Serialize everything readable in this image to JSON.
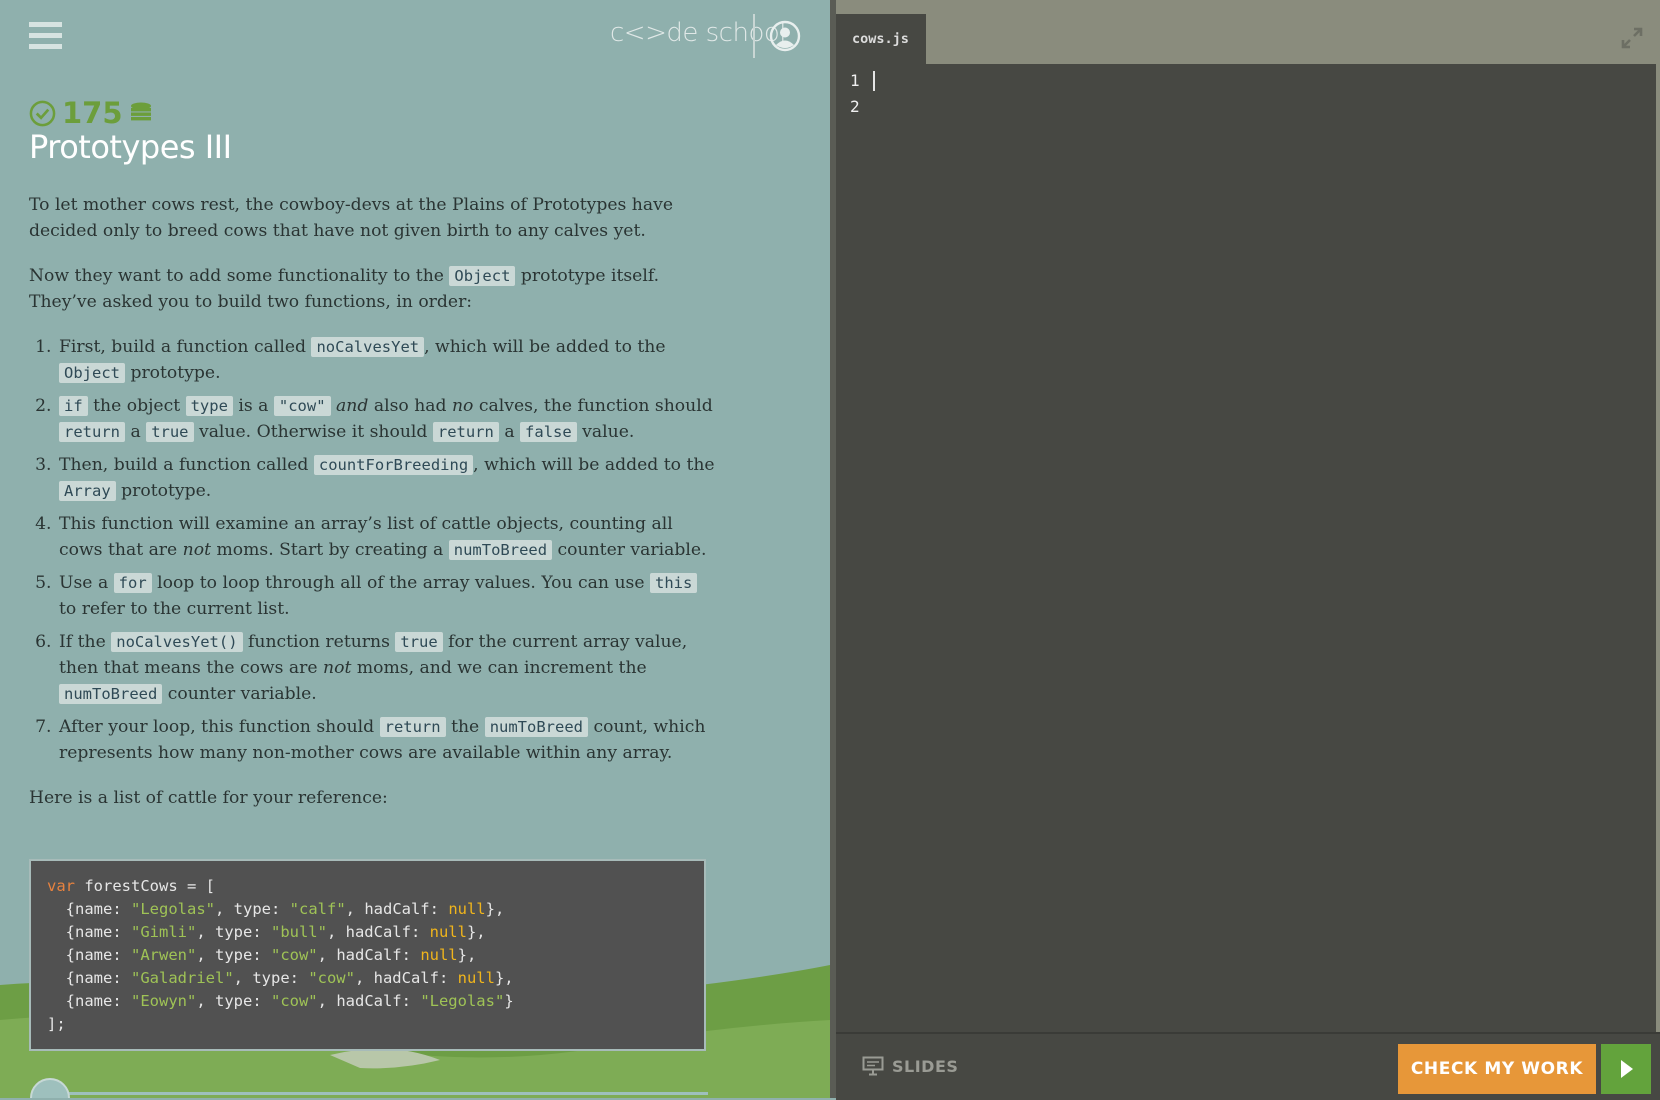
{
  "header": {
    "logo_text": "c<>de school",
    "menu_icon": "hamburger-menu-icon",
    "profile_icon": "user-profile-icon"
  },
  "challenge": {
    "points": "175",
    "title": "Prototypes III",
    "intro": "To let mother cows rest, the cowboy-devs at the Plains of Prototypes have decided only to breed cows that have not given birth to any calves yet.",
    "p2_pre": "Now they want to add some functionality to the ",
    "p2_code": "Object",
    "p2_post": " prototype itself. They’ve asked you to build two functions, in order:",
    "step1": {
      "t1": "First, build a function called ",
      "c1": "noCalvesYet",
      "t2": ", which will be added to the ",
      "c2": "Object",
      "t3": " prototype."
    },
    "step2": {
      "c1": "if",
      "t1": " the object ",
      "c2": "type",
      "t2": " is a ",
      "c3": "\"cow\"",
      "em1": "and",
      "t3": " also had ",
      "em2": "no",
      "t4": " calves, the function should ",
      "c4": "return",
      "t5": " a ",
      "c5": "true",
      "t6": " value. Otherwise it should ",
      "c6": "return",
      "t7": " a ",
      "c7": "false",
      "t8": " value."
    },
    "step3": {
      "t1": "Then, build a function called ",
      "c1": "countForBreeding",
      "t2": ", which will be added to the ",
      "c2": "Array",
      "t3": " prototype."
    },
    "step4": {
      "t1": "This function will examine an array’s list of cattle objects, counting all cows that are ",
      "em1": "not",
      "t2": " moms. Start by creating a ",
      "c1": "numToBreed",
      "t3": " counter variable."
    },
    "step5": {
      "t1": "Use a ",
      "c1": "for",
      "t2": " loop to loop through all of the array values. You can use ",
      "c2": "this",
      "t3": " to refer to the current list."
    },
    "step6": {
      "t1": "If the ",
      "c1": "noCalvesYet()",
      "t2": " function returns ",
      "c2": "true",
      "t3": " for the current array value, then that means the cows are ",
      "em1": "not",
      "t4": " moms, and we can increment the ",
      "c3": "numToBreed",
      "t5": " counter variable."
    },
    "step7": {
      "t1": "After your loop, this function should ",
      "c1": "return",
      "t2": " the ",
      "c2": "numToBreed",
      "t3": " count, which represents how many non-mother cows are available within any array."
    },
    "reference_label": "Here is a list of cattle for your reference:"
  },
  "code_sample": {
    "line0_kw": "var",
    "line0_rest": " forestCows = [",
    "rows": [
      {
        "pre": "  {name: ",
        "name": "\"Legolas\"",
        "mid": ", type: ",
        "type": "\"calf\"",
        "mid2": ", hadCalf: ",
        "calf": "null",
        "calf_is_null": true,
        "post": "},"
      },
      {
        "pre": "  {name: ",
        "name": "\"Gimli\"",
        "mid": ", type: ",
        "type": "\"bull\"",
        "mid2": ", hadCalf: ",
        "calf": "null",
        "calf_is_null": true,
        "post": "},"
      },
      {
        "pre": "  {name: ",
        "name": "\"Arwen\"",
        "mid": ", type: ",
        "type": "\"cow\"",
        "mid2": ", hadCalf: ",
        "calf": "null",
        "calf_is_null": true,
        "post": "},"
      },
      {
        "pre": "  {name: ",
        "name": "\"Galadriel\"",
        "mid": ", type: ",
        "type": "\"cow\"",
        "mid2": ", hadCalf: ",
        "calf": "null",
        "calf_is_null": true,
        "post": "},"
      },
      {
        "pre": "  {name: ",
        "name": "\"Eowyn\"",
        "mid": ", type: ",
        "type": "\"cow\"",
        "mid2": ", hadCalf: ",
        "calf": "\"Legolas\"",
        "calf_is_null": false,
        "post": "}"
      }
    ],
    "last_line": "];"
  },
  "editor": {
    "tab_name": "cows.js",
    "line_numbers": [
      "1",
      "2"
    ],
    "expand_icon": "expand-arrows-icon"
  },
  "footer": {
    "slides_label": "SLIDES",
    "slides_icon": "slides-presentation-icon",
    "check_label": "CHECK MY WORK",
    "run_icon": "play-icon"
  },
  "colors": {
    "accent_orange": "#e79739",
    "accent_green": "#63a33c",
    "panel_bg": "#8fb0ad",
    "editor_bg": "#474843"
  }
}
